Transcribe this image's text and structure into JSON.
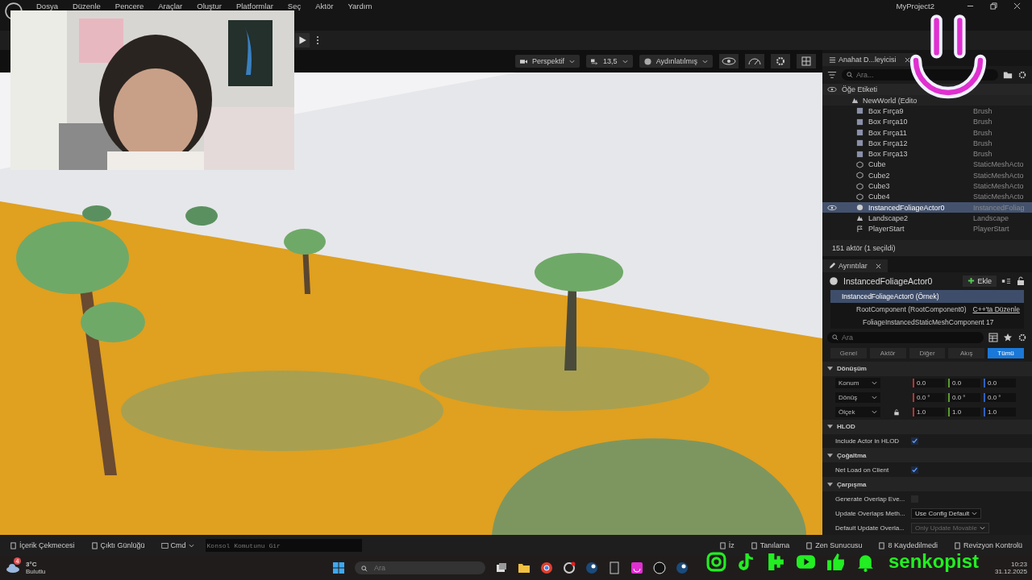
{
  "window": {
    "title": "MyProject2"
  },
  "menu": [
    "Dosya",
    "Düzenle",
    "Pencere",
    "Araçlar",
    "Oluştur",
    "Platformlar",
    "Seç",
    "Aktör",
    "Yardım"
  ],
  "viewport_toolbar": {
    "view": "Perspektif",
    "speed": "13,5",
    "mode": "Aydınlatılmış"
  },
  "outliner": {
    "tab": "Anahat D...leyicisi",
    "search": {
      "placeholder": "Ara..."
    },
    "column": "Öğe Etiketi",
    "tree": {
      "name": "NewWorld (Edito",
      "children": [
        {
          "name": "Box Fırça9",
          "type": "Brush",
          "kind": "brush",
          "selected": false
        },
        {
          "name": "Box Fırça10",
          "type": "Brush",
          "kind": "brush",
          "selected": false
        },
        {
          "name": "Box Fırça11",
          "type": "Brush",
          "kind": "brush",
          "selected": false
        },
        {
          "name": "Box Fırça12",
          "type": "Brush",
          "kind": "brush",
          "selected": false
        },
        {
          "name": "Box Fırça13",
          "type": "Brush",
          "kind": "brush",
          "selected": false
        },
        {
          "name": "Cube",
          "type": "StaticMeshActo",
          "kind": "mesh",
          "selected": false
        },
        {
          "name": "Cube2",
          "type": "StaticMeshActo",
          "kind": "mesh",
          "selected": false
        },
        {
          "name": "Cube3",
          "type": "StaticMeshActo",
          "kind": "mesh",
          "selected": false
        },
        {
          "name": "Cube4",
          "type": "StaticMeshActo",
          "kind": "mesh",
          "selected": false
        },
        {
          "name": "InstancedFoliageActor0",
          "type": "InstancedFoliag",
          "kind": "foliage",
          "selected": true
        },
        {
          "name": "Landscape2",
          "type": "Landscape",
          "kind": "landscape",
          "selected": false
        },
        {
          "name": "PlayerStart",
          "type": "PlayerStart",
          "kind": "start",
          "selected": false
        }
      ]
    },
    "footer": "151 aktör (1 seçildi)"
  },
  "details": {
    "tab": "Ayrıntılar",
    "actor": "InstancedFoliageActor0",
    "add_button": "Ekle",
    "components": [
      {
        "name": "InstancedFoliageActor0 (Örnek)",
        "selected": true
      },
      {
        "name": "RootComponent (RootComponent0)",
        "link": "C++'ta Düzenle",
        "selected": false
      },
      {
        "name": "FoliageInstancedStaticMeshComponent  17",
        "selected": false
      }
    ],
    "search": {
      "placeholder": "Ara"
    },
    "filters": [
      {
        "label": "Genel",
        "selected": false
      },
      {
        "label": "Aktör",
        "selected": false
      },
      {
        "label": "Diğer",
        "selected": false
      },
      {
        "label": "Akış",
        "selected": false
      },
      {
        "label": "Tümü",
        "selected": true
      }
    ],
    "sections": [
      {
        "title": "Dönüşüm",
        "rows": [
          {
            "kind": "vector",
            "label": "Konum",
            "values": [
              "0.0",
              "0.0",
              "0.0"
            ]
          },
          {
            "kind": "vector",
            "label": "Dönüş",
            "values": [
              "0.0 °",
              "0.0 °",
              "0.0 °"
            ]
          },
          {
            "kind": "vector",
            "label": "Ölçek",
            "values": [
              "1.0",
              "1.0",
              "1.0"
            ]
          }
        ]
      },
      {
        "title": "HLOD",
        "rows": [
          {
            "kind": "checkbox",
            "label": "Include Actor in HLOD",
            "checked": true
          }
        ]
      },
      {
        "title": "Çoğaltma",
        "rows": [
          {
            "kind": "checkbox",
            "label": "Net Load on Client",
            "checked": true
          }
        ]
      },
      {
        "title": "Çarpışma",
        "rows": [
          {
            "kind": "checkbox",
            "label": "Generate Overlap Eve...",
            "checked": false
          },
          {
            "kind": "dropdown",
            "label": "Update Overlaps Meth...",
            "value": "Use Config Default",
            "disabled": false
          },
          {
            "kind": "dropdown",
            "label": "Default Update Overla...",
            "value": "Only Update Movable",
            "disabled": true
          }
        ]
      }
    ]
  },
  "bottom_bar": {
    "left": [
      "İçerik Çekmecesi",
      "Çıktı Günlüğü"
    ],
    "cmd": "Cmd",
    "console": {
      "placeholder": "Konsol Komutunu Gir"
    },
    "right": [
      "İz",
      "Tanılama",
      "Zen Sunucusu",
      "8 Kaydedilmedi",
      "Revizyon Kontrolü"
    ]
  },
  "taskbar": {
    "weather": {
      "temp": "3°C",
      "desc": "Bulutlu",
      "badge": "4"
    },
    "search": {
      "placeholder": "Ara"
    },
    "time": "10:23",
    "date": "31.12.2025"
  },
  "stream_overlay": {
    "name": "senkopist"
  }
}
